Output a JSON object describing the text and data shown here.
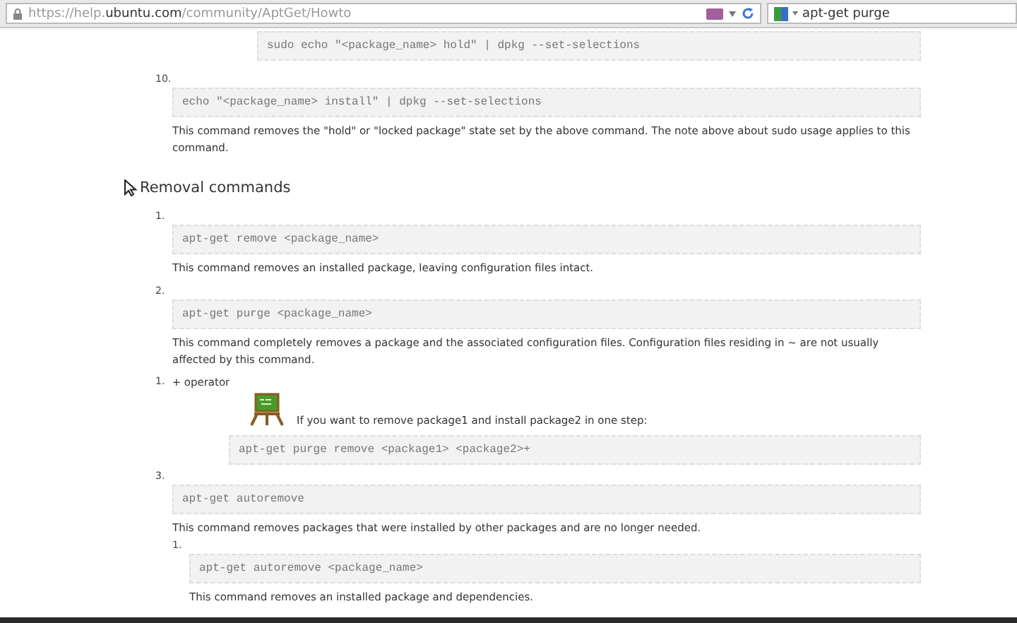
{
  "browser": {
    "url": "https://help.**ubuntu.com**/community/AptGet/Howto",
    "search_query": "apt-get purge"
  },
  "content": [
    {
      "kind": "code",
      "code": "sudo echo \"<package_name> hold\" | dpkg --set-selections"
    },
    {
      "kind": "step",
      "number": "10.",
      "code": "echo \"<package_name> install\" | dpkg --set-selections",
      "description": "This command removes the \"hold\" or \"locked package\" state set by the above command. The note above about sudo usage applies to this command."
    },
    {
      "kind": "heading",
      "text": "Removal commands"
    },
    {
      "kind": "step",
      "number": "1.",
      "code": "apt-get remove <package_name>",
      "description": "This command removes an installed package, leaving configuration files intact."
    },
    {
      "kind": "step",
      "number": "2.",
      "code": "apt-get purge <package_name>",
      "description": "This command completely removes a package and the associated configuration files. Configuration files residing in ~ are not usually affected by this command.",
      "children": [
        {
          "kind": "tip",
          "number": "1.",
          "label": "+ operator",
          "text": "If you want to remove package1 and install package2 in one step:",
          "code": "apt-get purge remove <package1> <package2>+"
        }
      ]
    },
    {
      "kind": "step",
      "number": "3.",
      "code": "apt-get autoremove",
      "description": "This command removes packages that were installed by other packages and are no longer needed.",
      "children": [
        {
          "kind": "step",
          "number": "1.",
          "code": "apt-get autoremove <package_name>",
          "description": "This command removes an installed package and dependencies."
        }
      ]
    }
  ]
}
